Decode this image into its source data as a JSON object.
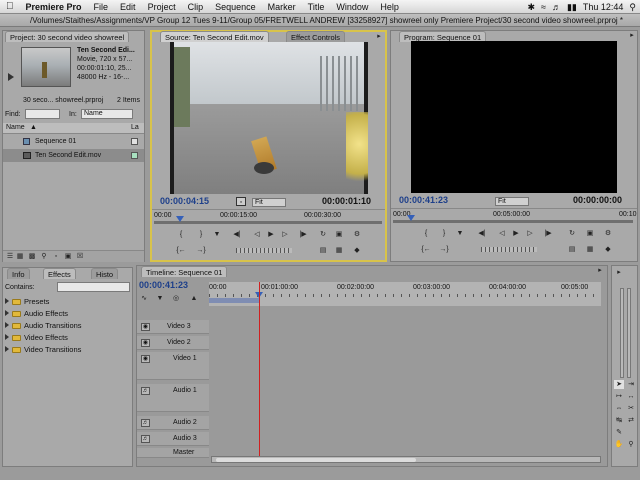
{
  "menubar": {
    "apple": "",
    "app_name": "Premiere Pro",
    "items": [
      "File",
      "Edit",
      "Project",
      "Clip",
      "Sequence",
      "Marker",
      "Title",
      "Window",
      "Help"
    ],
    "clock": "Thu 12:44"
  },
  "window_title": "/Volumes/Staithes/Assignments/VP Group 12 Tues 9-11/Group 05/FRETWELL ANDREW [33258927] showreel only Premiere Project/30 second video showreel.prproj *",
  "project": {
    "tab": "Project: 30 second video showreel",
    "clip_name": "Ten Second Edi...",
    "clip_type": "Movie, 720 x 57...",
    "clip_duration": "00:00:01:10, 25...",
    "clip_audio": "48000 Hz - 16-...",
    "project_file": "30 seco... showreel.prproj",
    "item_count": "2 Items",
    "find_label": "Find:",
    "in_label": "In:",
    "in_value": "Name",
    "col_name": "Name",
    "col_label": "La",
    "items": [
      "Sequence 01",
      "Ten Second Edit.mov"
    ]
  },
  "source": {
    "tab": "Source: Ten Second Edit.mov",
    "tab2": "Effect Controls",
    "timecode_left": "00:00:04:15",
    "fit": "Fit",
    "timecode_right": "00:00:01:10",
    "ruler": [
      "00:00",
      "00:00:15:00",
      "00:00:30:00"
    ]
  },
  "program": {
    "tab": "Program: Sequence 01",
    "timecode_left": "00:00:41:23",
    "fit": "Fit",
    "timecode_right": "00:00:00:00",
    "ruler": [
      "00:00",
      "00:05:00:00",
      "00:10"
    ]
  },
  "effects": {
    "tabs": [
      "Info",
      "Effects",
      "Histo"
    ],
    "contains_label": "Contains:",
    "items": [
      "Presets",
      "Audio Effects",
      "Audio Transitions",
      "Video Effects",
      "Video Transitions"
    ]
  },
  "timeline": {
    "tab": "Timeline: Sequence 01",
    "timecode": "00:00:41:23",
    "ruler": [
      "00:00",
      "00:01:00:00",
      "00:02:00:00",
      "00:03:00:00",
      "00:04:00:00",
      "00:05:00"
    ],
    "tracks": [
      "Video 3",
      "Video 2",
      "Video 1",
      "Audio 1",
      "Audio 2",
      "Audio 3",
      "Master"
    ]
  },
  "colors": {
    "timecode_blue": "#1d3f8a",
    "highlight_yellow": "#d8c34a",
    "playhead_red": "#d02020",
    "clip_blue": "#7f8db3"
  }
}
